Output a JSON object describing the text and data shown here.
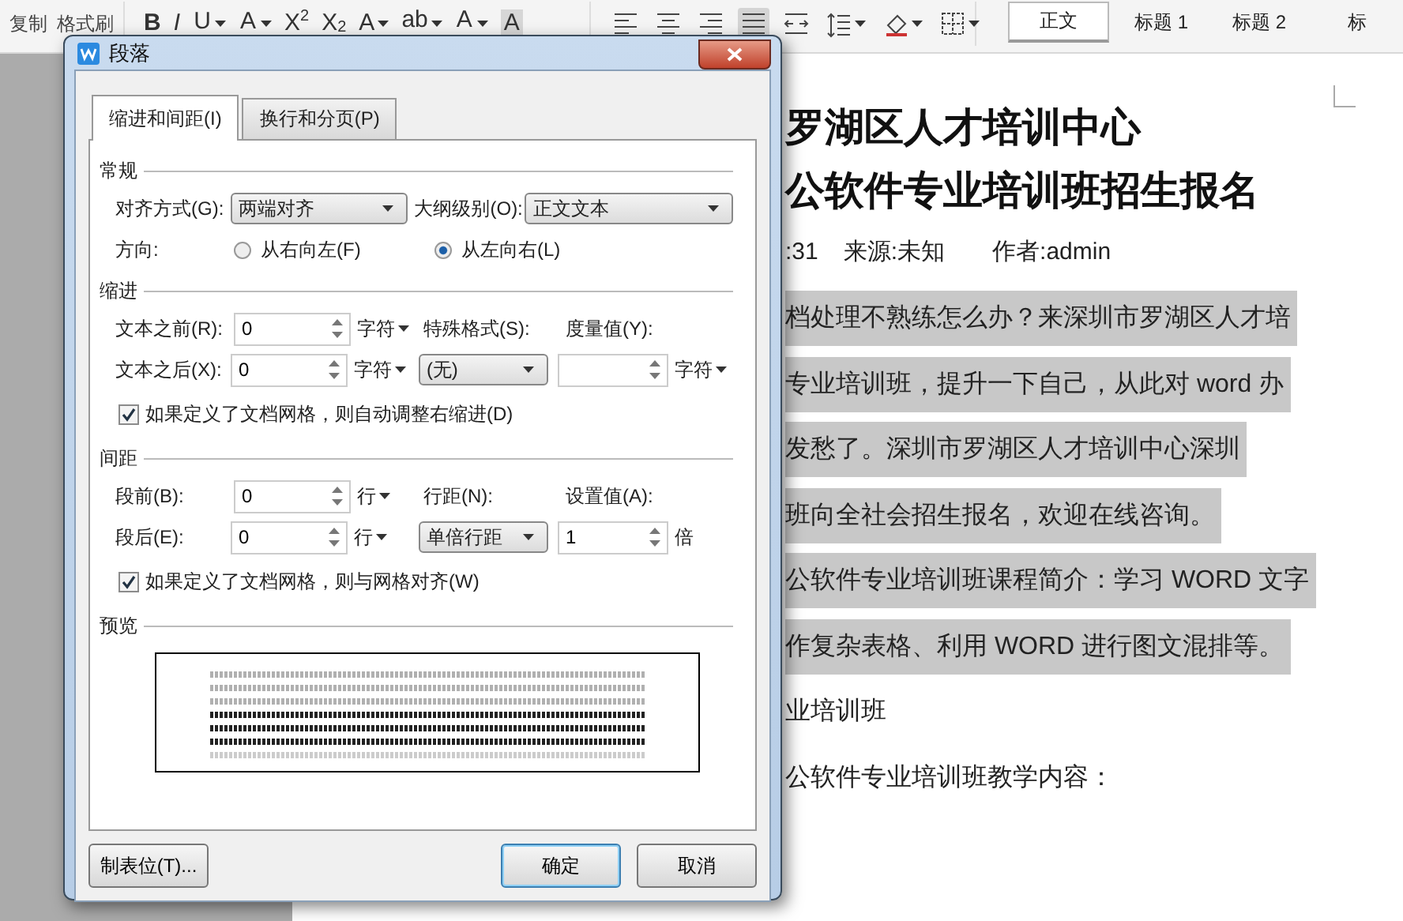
{
  "ribbon": {
    "clipboard": [
      {
        "label": "复制"
      },
      {
        "label": "格式刷"
      }
    ],
    "font_tools": [
      {
        "kind": "bold",
        "glyph": "B",
        "dropdown": false
      },
      {
        "kind": "italic",
        "glyph": "I",
        "dropdown": false
      },
      {
        "kind": "underline",
        "glyph": "U",
        "dropdown": true
      },
      {
        "kind": "strike",
        "glyph": "A",
        "dropdown": true
      },
      {
        "kind": "super",
        "glyph": "X$^{2}$",
        "dropdown": false
      },
      {
        "kind": "sub",
        "glyph": "X$_{2}$",
        "dropdown": false
      },
      {
        "kind": "plain",
        "glyph": "A",
        "dropdown": true
      },
      {
        "kind": "highlight",
        "glyph": "ab",
        "dropdown": true
      },
      {
        "kind": "color",
        "glyph": "A",
        "dropdown": true
      },
      {
        "kind": "shade",
        "glyph": "A",
        "dropdown": false
      }
    ],
    "paragraph_tools": [
      {
        "kind": "align-left",
        "selected": false,
        "dropdown": false
      },
      {
        "kind": "align-center",
        "selected": false,
        "dropdown": false
      },
      {
        "kind": "align-right",
        "selected": false,
        "dropdown": false
      },
      {
        "kind": "justify",
        "selected": true,
        "dropdown": false
      },
      {
        "kind": "distribute",
        "selected": false,
        "dropdown": false
      },
      {
        "kind": "line-spacing",
        "selected": false,
        "dropdown": true
      },
      {
        "kind": "shading",
        "selected": false,
        "dropdown": true
      },
      {
        "kind": "borders",
        "selected": false,
        "dropdown": true
      }
    ],
    "styles": [
      {
        "label": "正文",
        "selected": true
      },
      {
        "label": "标题 1",
        "selected": false
      },
      {
        "label": "标题 2",
        "selected": false
      },
      {
        "label": "标",
        "selected": false
      }
    ]
  },
  "document": {
    "title_lines": [
      "罗湖区人才培训中心",
      "公软件专业培训班招生报名"
    ],
    "meta": [
      ":31",
      "来源:未知",
      "作者:admin"
    ],
    "lines": [
      {
        "text": "档处理不熟练怎么办？来深圳市罗湖区人才培",
        "highlighted": true
      },
      {
        "text": "专业培训班，提升一下自己，从此对 word 办",
        "highlighted": true
      },
      {
        "text": "发愁了。深圳市罗湖区人才培训中心深圳",
        "highlighted": true
      },
      {
        "text": "班向全社会招生报名，欢迎在线咨询。",
        "highlighted": true
      },
      {
        "text": "公软件专业培训班课程简介：学习 WORD 文字",
        "highlighted": true
      },
      {
        "text": "作复杂表格、利用 WORD 进行图文混排等。",
        "highlighted": true
      },
      {
        "text": "业培训班",
        "highlighted": false
      },
      {
        "text": "公软件专业培训班教学内容：",
        "highlighted": false
      }
    ]
  },
  "dialog": {
    "title": "段落",
    "tabs": [
      {
        "label": "缩进和间距(I)",
        "selected": true
      },
      {
        "label": "换行和分页(P)",
        "selected": false
      }
    ],
    "general": {
      "title": "常规",
      "alignment": {
        "label": "对齐方式(G):",
        "value": "两端对齐"
      },
      "outline": {
        "label": "大纲级别(O):",
        "value": "正文文本"
      },
      "direction": {
        "label": "方向:",
        "options": [
          {
            "label": "从右向左(F)",
            "selected": false
          },
          {
            "label": "从左向右(L)",
            "selected": true
          }
        ]
      }
    },
    "indent": {
      "title": "缩进",
      "before": {
        "label": "文本之前(R):",
        "value": "0",
        "unit": "字符"
      },
      "after": {
        "label": "文本之后(X):",
        "value": "0",
        "unit": "字符"
      },
      "special": {
        "label": "特殊格式(S):",
        "value": "(无)"
      },
      "measure": {
        "label": "度量值(Y):",
        "unit": "字符"
      },
      "grid": {
        "label": "如果定义了文档网格，则自动调整右缩进(D)",
        "checked": true
      }
    },
    "spacing": {
      "title": "间距",
      "before": {
        "label": "段前(B):",
        "value": "0",
        "unit": "行"
      },
      "after": {
        "label": "段后(E):",
        "value": "0",
        "unit": "行"
      },
      "line_spacing": {
        "label": "行距(N):",
        "value": "单倍行距"
      },
      "setting": {
        "label": "设置值(A):",
        "value": "1",
        "unit": "倍"
      },
      "grid": {
        "label": "如果定义了文档网格，则与网格对齐(W)",
        "checked": true
      }
    },
    "preview": {
      "title": "预览"
    },
    "buttons": [
      {
        "label": "制表位(T)...",
        "kind": "left",
        "default": false
      },
      {
        "label": "确定",
        "kind": "right",
        "default": true
      },
      {
        "label": "取消",
        "kind": "right",
        "default": false
      }
    ]
  }
}
